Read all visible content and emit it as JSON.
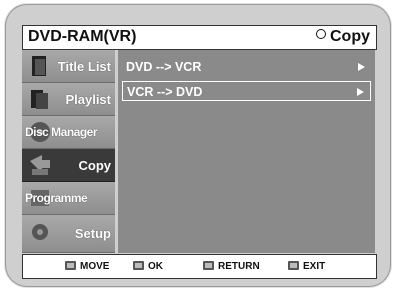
{
  "header": {
    "title": "DVD-RAM(VR)",
    "mode_label": "Copy"
  },
  "menu": {
    "items": [
      {
        "label": "Title List",
        "icon": "title-list-icon"
      },
      {
        "label": "Playlist",
        "icon": "playlist-icon"
      },
      {
        "label": "Disc Manager",
        "icon": "disc-manager-icon"
      },
      {
        "label": "Copy",
        "icon": "copy-icon"
      },
      {
        "label": "Programme",
        "icon": "programme-icon"
      },
      {
        "label": "Setup",
        "icon": "setup-icon"
      }
    ],
    "active_index": 3
  },
  "content": {
    "options": [
      {
        "label": "DVD --> VCR",
        "selected": false
      },
      {
        "label": "VCR --> DVD",
        "selected": true
      }
    ]
  },
  "footer": {
    "move": "MOVE",
    "ok": "OK",
    "return": "RETURN",
    "exit": "EXIT"
  }
}
